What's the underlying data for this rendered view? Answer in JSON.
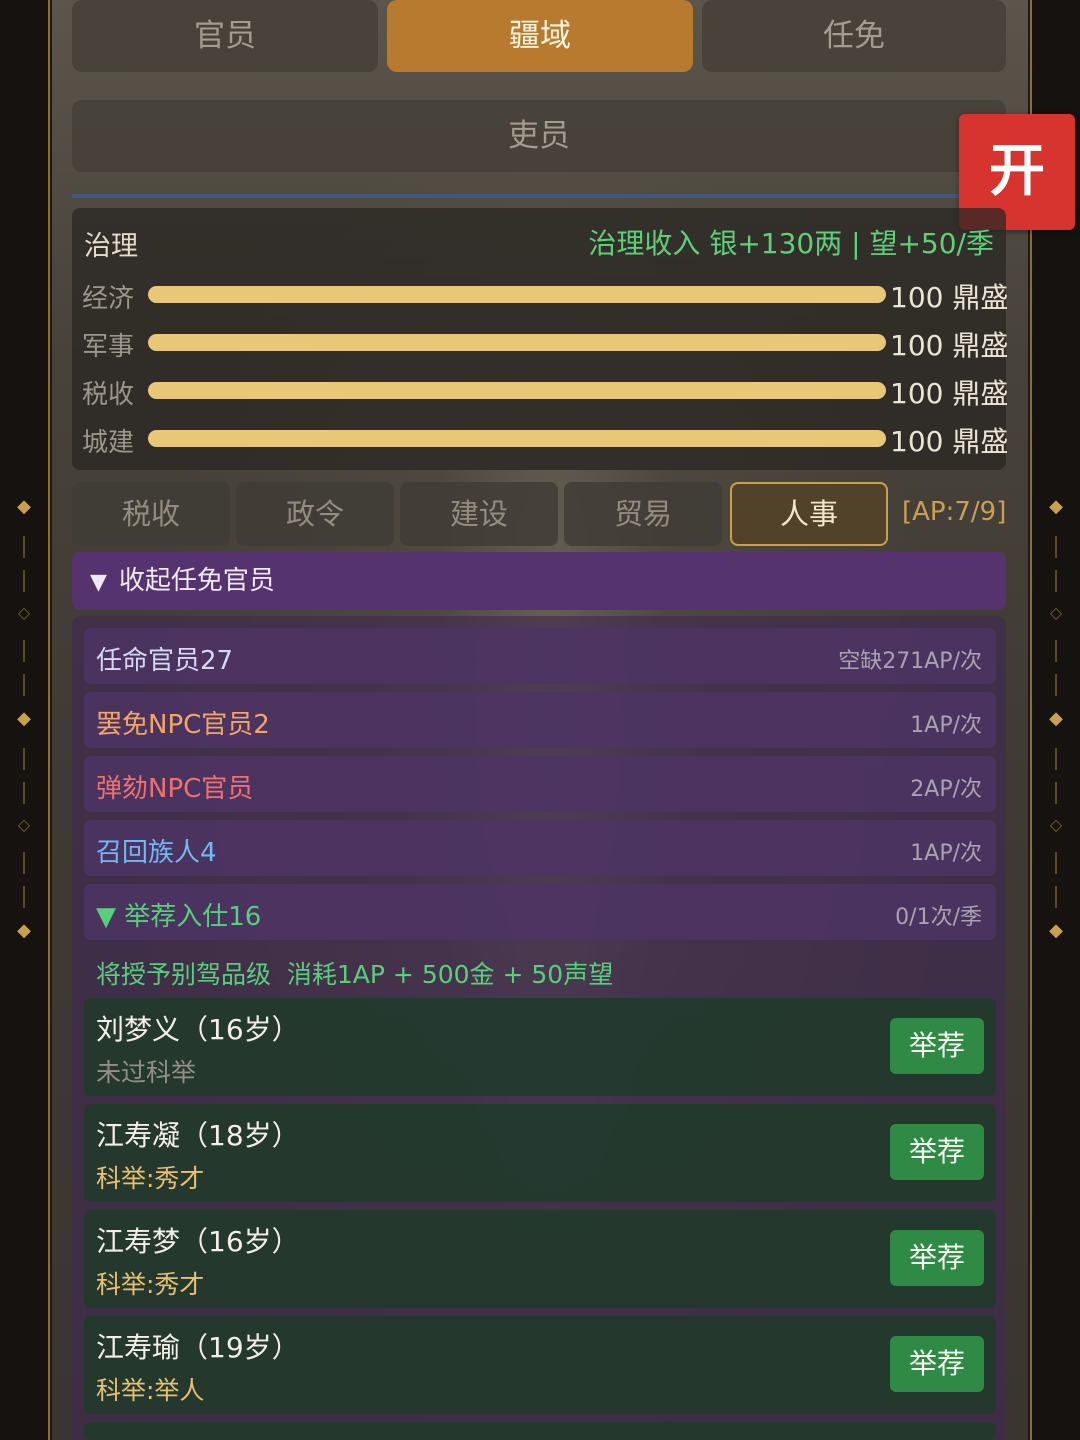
{
  "top_tabs": [
    {
      "label": "官员",
      "active": false
    },
    {
      "label": "疆域",
      "active": true
    },
    {
      "label": "任免",
      "active": false
    }
  ],
  "sub_tab": {
    "label": "吏员"
  },
  "open_button": {
    "label": "开"
  },
  "governance": {
    "title": "治理",
    "income": "治理收入 银+130两 | 望+50/季",
    "rows": [
      {
        "label": "经济",
        "value_text": "100 鼎盛",
        "level": 1.0
      },
      {
        "label": "军事",
        "value_text": "100 鼎盛",
        "level": 1.0
      },
      {
        "label": "税收",
        "value_text": "100 鼎盛",
        "level": 1.0
      },
      {
        "label": "城建",
        "value_text": "100 鼎盛",
        "level": 1.0
      }
    ]
  },
  "category_tabs": [
    {
      "label": "税收",
      "active": false
    },
    {
      "label": "政令",
      "active": false
    },
    {
      "label": "建设",
      "active": false
    },
    {
      "label": "贸易",
      "active": false
    },
    {
      "label": "人事",
      "active": true
    }
  ],
  "ap": "[AP:7/9]",
  "collapse": {
    "arrow": "▼",
    "label": "收起任免官员"
  },
  "actions": [
    {
      "label": "任命官员27",
      "cost": "空缺271AP/次",
      "color": "light"
    },
    {
      "label": "罢免NPC官员2",
      "cost": "1AP/次",
      "color": "orange"
    },
    {
      "label": "弹劾NPC官员",
      "cost": "2AP/次",
      "color": "red"
    },
    {
      "label": "召回族人4",
      "cost": "1AP/次",
      "color": "blue"
    },
    {
      "label": "▼ 举荐入仕16",
      "cost": "0/1次/季",
      "color": "green"
    }
  ],
  "recommend_note": "将授予别驾品级  消耗1AP + 500金 + 50声望",
  "candidates": [
    {
      "name": "刘梦义（16岁）",
      "exam": "未过科举",
      "passed": false,
      "button": "举荐"
    },
    {
      "name": "江寿凝（18岁）",
      "exam": "科举:秀才",
      "passed": true,
      "button": "举荐"
    },
    {
      "name": "江寿梦（16岁）",
      "exam": "科举:秀才",
      "passed": true,
      "button": "举荐"
    },
    {
      "name": "江寿瑜（19岁）",
      "exam": "科举:举人",
      "passed": true,
      "button": "举荐"
    }
  ],
  "colors": {
    "accent_gold": "#c9a14e",
    "active_tab": "#b87a2e",
    "open_button": "#d7332f",
    "progress_fill": "#e8c878",
    "recommend_button": "#2f8a45",
    "income_green": "#5fd07a"
  }
}
